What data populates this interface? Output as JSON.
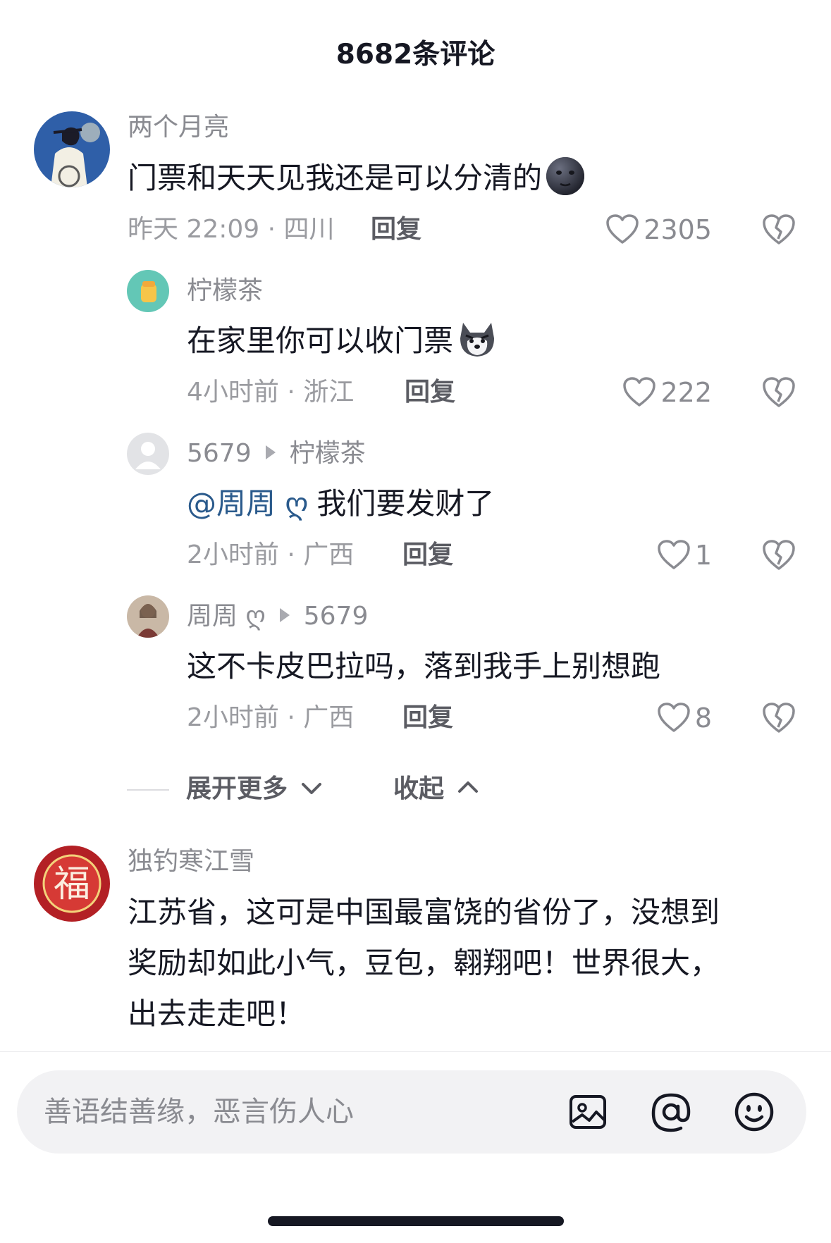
{
  "header": {
    "title": "8682条评论"
  },
  "comments": [
    {
      "username": "两个月亮",
      "text": "门票和天天见我还是可以分清的",
      "time_location": "昨天 22:09 · 四川",
      "reply_label": "回复",
      "likes": "2305",
      "emoji": "new-moon-face-emoji"
    },
    {
      "username": "柠檬茶",
      "text": "在家里你可以收门票",
      "time_location": "4小时前 · 浙江",
      "reply_label": "回复",
      "likes": "222",
      "emoji": "husky-dog-emoji"
    },
    {
      "username": "5679",
      "reply_to": "柠檬茶",
      "mention": "@周周 ღ",
      "text": "我们要发财了",
      "time_location": "2小时前 · 广西",
      "reply_label": "回复",
      "likes": "1"
    },
    {
      "username": "周周 ღ",
      "reply_to": "5679",
      "text": "这不卡皮巴拉吗，落到我手上别想跑",
      "time_location": "2小时前 · 广西",
      "reply_label": "回复",
      "likes": "8"
    },
    {
      "username": "独钓寒江雪",
      "text_lines": [
        "江苏省，这可是中国最富饶的省份了，没想到",
        "奖励却如此小气，豆包，翱翔吧！世界很大，",
        "出去走走吧！"
      ],
      "avatar_char": "福"
    }
  ],
  "thread_controls": {
    "expand_more": "展开更多",
    "collapse": "收起"
  },
  "input": {
    "placeholder": "善语结善缘，恶言伤人心"
  },
  "icons": {
    "like": "heart-icon",
    "dislike": "broken-heart-icon",
    "image": "image-icon",
    "mention": "at-icon",
    "emoji": "smiley-icon",
    "expand": "chevron-down-icon",
    "collapse": "chevron-up-icon"
  },
  "colors": {
    "mention": "#2a5a8c",
    "meta": "#9a9ba0",
    "text": "#161823"
  }
}
